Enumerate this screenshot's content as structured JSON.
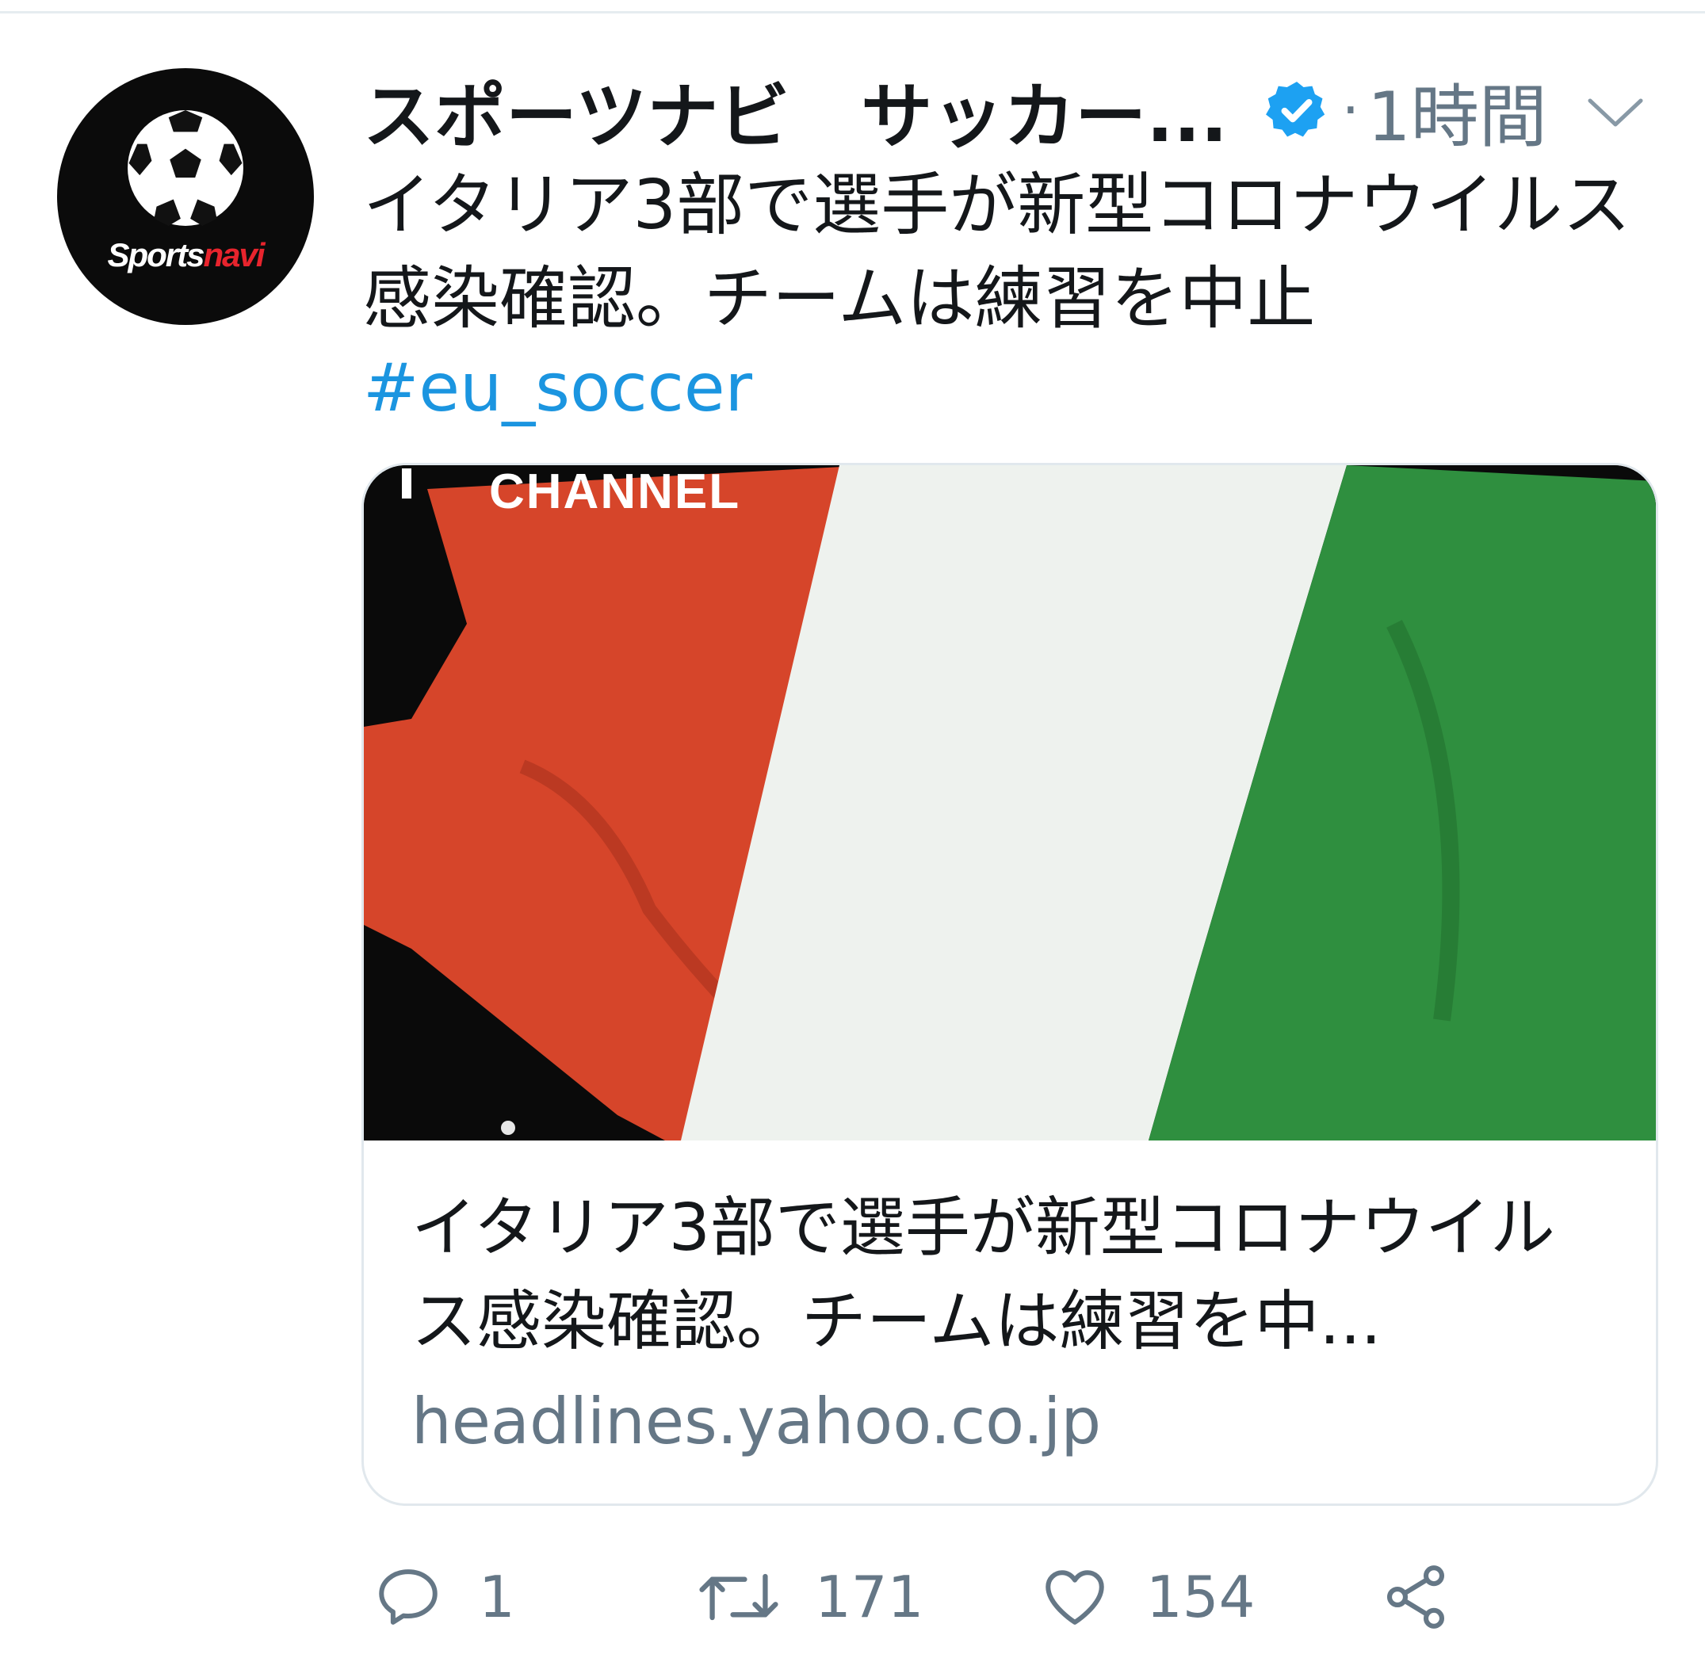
{
  "tweet": {
    "author_name": "スポーツナビ　サッカー...",
    "separator": "·",
    "time": "1時間",
    "text": "イタリア3部で選手が新型コロナウイルス感染確認。チームは練習を中止",
    "hashtag": "#eu_soccer",
    "avatar_logo": {
      "part1": "Sports",
      "part2": "navi"
    },
    "icons": {
      "verified": "verified-badge-icon",
      "more": "chevron-down-icon"
    }
  },
  "card": {
    "image_text": "CHANNEL",
    "title": "イタリア3部で選手が新型コロナウイルス感染確認。チームは練習を中...",
    "domain": "headlines.yahoo.co.jp"
  },
  "actions": {
    "reply_count": "1",
    "retweet_count": "171",
    "like_count": "154"
  },
  "colors": {
    "link": "#1b95e0",
    "verified": "#1da1f2",
    "secondary_text": "#657786",
    "flag_red": "#d6452a",
    "flag_white": "#eef2ee",
    "flag_green": "#2f8f3f"
  }
}
